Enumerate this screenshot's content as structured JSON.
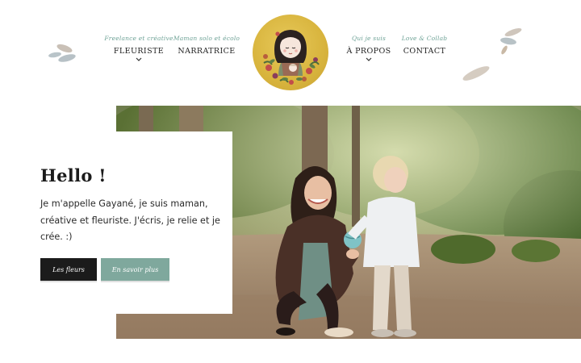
{
  "header": {
    "nav_left": [
      {
        "tagline": "Freelance et créative",
        "label": "FLEURISTE",
        "has_dropdown": true
      },
      {
        "tagline": "Maman solo et écolo",
        "label": "NARRATRICE",
        "has_dropdown": false
      }
    ],
    "nav_right": [
      {
        "tagline": "Qui je suis",
        "label": "À PROPOS",
        "has_dropdown": true
      },
      {
        "tagline": "Love & Collab",
        "label": "CONTACT",
        "has_dropdown": false
      }
    ]
  },
  "hero": {
    "title": "Hello !",
    "text": "Je m'appelle Gayané, je suis maman, créative et fleuriste. J'écris, je relie et je crée. :)",
    "buttons": {
      "primary": "Les fleurs",
      "secondary": "En savoir plus"
    }
  },
  "colors": {
    "accent_green": "#7fa89d",
    "tagline_green": "#6fa397",
    "dark_button": "#1b1b1b",
    "logo_yellow": "#d8b43d"
  },
  "icons": [
    "leaf-decoration-icon",
    "chevron-down-icon",
    "logo-illustration"
  ]
}
